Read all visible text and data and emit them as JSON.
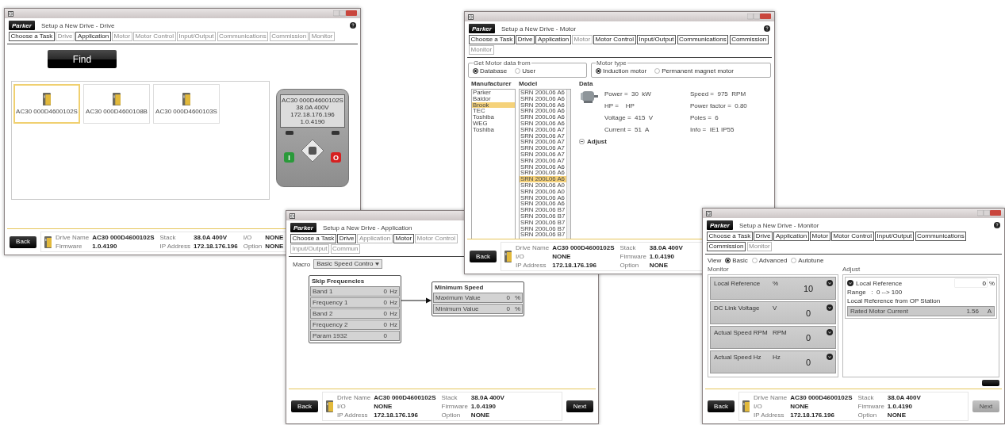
{
  "windows": [
    {
      "kind": "drive",
      "title": "Setup a New Drive - Drive",
      "logo": "Parker",
      "tabs": [
        {
          "label": "Choose a Task",
          "disabled": false
        },
        {
          "label": "Drive",
          "disabled": true
        },
        {
          "label": "Application",
          "disabled": false
        },
        {
          "label": "Motor",
          "disabled": true
        },
        {
          "label": "Motor Control",
          "disabled": true
        },
        {
          "label": "Input/Output",
          "disabled": true
        },
        {
          "label": "Communications",
          "disabled": true
        },
        {
          "label": "Commission",
          "disabled": true
        },
        {
          "label": "Monitor",
          "disabled": true
        }
      ],
      "find_button": "Find",
      "devices": [
        {
          "name": "AC30 000D4600102S",
          "selected": true
        },
        {
          "name": "AC30 000D4600108B",
          "selected": false
        },
        {
          "name": "AC30 000D4600103S",
          "selected": false
        }
      ],
      "keypad": {
        "lines": [
          "AC30 000D4600102S",
          "38.0A 400V",
          "172.18.176.196",
          "1.0.4190"
        ],
        "start_key": "I",
        "stop_key": "O"
      },
      "back_button": "Back",
      "drive_info": [
        {
          "label": "Drive Name",
          "value": "AC30 000D4600102S"
        },
        {
          "label": "Stack",
          "value": "38.0A 400V"
        },
        {
          "label": "I/O",
          "value": "NONE"
        },
        {
          "label": "Firmware",
          "value": "1.0.4190"
        },
        {
          "label": "IP Address",
          "value": "172.18.176.196"
        },
        {
          "label": "Option",
          "value": "NONE"
        }
      ]
    },
    {
      "kind": "application",
      "title": "Setup a New Drive - Application",
      "logo": "Parker",
      "tabs": [
        {
          "label": "Choose a Task",
          "disabled": false
        },
        {
          "label": "Drive",
          "disabled": false
        },
        {
          "label": "Application",
          "disabled": true
        },
        {
          "label": "Motor",
          "disabled": false
        },
        {
          "label": "Motor Control",
          "disabled": true
        },
        {
          "label": "Input/Output",
          "disabled": true
        },
        {
          "label": "Commun",
          "disabled": true
        }
      ],
      "macro": {
        "label": "Macro",
        "value": "Basic Speed Contro"
      },
      "blocks": [
        {
          "title": "Skip Frequencies",
          "rows": [
            {
              "name": "Band 1",
              "value": "0",
              "unit": "Hz"
            },
            {
              "name": "Frequency 1",
              "value": "0",
              "unit": "Hz"
            },
            {
              "name": "Band 2",
              "value": "0",
              "unit": "Hz"
            },
            {
              "name": "Frequency 2",
              "value": "0",
              "unit": "Hz"
            },
            {
              "name": "Param 1932",
              "value": "0"
            }
          ]
        },
        {
          "title": "Minimum Speed",
          "rows": [
            {
              "name": "Maximum Value",
              "value": "0",
              "unit": "%"
            },
            {
              "name": "Minimum Value",
              "value": "0",
              "unit": "%"
            }
          ]
        }
      ],
      "back_button": "Back",
      "drive_info": [
        {
          "label": "Drive Name",
          "value": "AC30 000D4600102S"
        },
        {
          "label": "Stack",
          "value": "38.0A 400V"
        },
        {
          "label": "I/O",
          "value": "NONE"
        },
        {
          "label": "Firmware",
          "value": "1.0.4190"
        },
        {
          "label": "IP Address",
          "value": "172.18.176.196"
        },
        {
          "label": "Option",
          "value": "NONE"
        }
      ],
      "next_button": {
        "label": "Next",
        "disabled": false
      }
    },
    {
      "kind": "motor",
      "title": "Setup a New Drive - Motor",
      "logo": "Parker",
      "tabs": [
        {
          "label": "Choose a Task",
          "disabled": false
        },
        {
          "label": "Drive",
          "disabled": false
        },
        {
          "label": "Application",
          "disabled": false
        },
        {
          "label": "Motor",
          "disabled": true
        },
        {
          "label": "Motor Control",
          "disabled": false
        },
        {
          "label": "Input/Output",
          "disabled": false
        },
        {
          "label": "Communications",
          "disabled": false
        },
        {
          "label": "Commission",
          "disabled": false
        },
        {
          "label": "Monitor",
          "disabled": true
        }
      ],
      "groups": [
        {
          "legend": "Get Motor data from",
          "options": [
            {
              "label": "Database",
              "selected": true
            },
            {
              "label": "User",
              "selected": false
            }
          ]
        },
        {
          "legend": "Motor type",
          "options": [
            {
              "label": "Induction motor",
              "selected": true
            },
            {
              "label": "Permanent magnet motor",
              "selected": false
            }
          ]
        }
      ],
      "manufacturer": {
        "heading": "Manufacturer",
        "items": [
          {
            "label": "Parker",
            "selected": false
          },
          {
            "label": "Baldor",
            "selected": false
          },
          {
            "label": "Brook",
            "selected": true
          },
          {
            "label": "TEC",
            "selected": false
          },
          {
            "label": "Toshiba",
            "selected": false
          },
          {
            "label": "WEG",
            "selected": false
          },
          {
            "label": "Toshiba",
            "selected": false
          }
        ]
      },
      "model": {
        "heading": "Model",
        "items": [
          {
            "label": "SRN 200L06 A6",
            "selected": false
          },
          {
            "label": "SRN 200L06 A6",
            "selected": false
          },
          {
            "label": "SRN 200L06 A6",
            "selected": false
          },
          {
            "label": "SRN 200L06 A6",
            "selected": false
          },
          {
            "label": "SRN 200L06 A6",
            "selected": false
          },
          {
            "label": "SRN 200L06 A6",
            "selected": false
          },
          {
            "label": "SRN 200L06 A7",
            "selected": false
          },
          {
            "label": "SRN 200L06 A7",
            "selected": false
          },
          {
            "label": "SRN 200L06 A7",
            "selected": false
          },
          {
            "label": "SRN 200L06 A7",
            "selected": false
          },
          {
            "label": "SRN 200L06 A7",
            "selected": false
          },
          {
            "label": "SRN 200L06 A7",
            "selected": false
          },
          {
            "label": "SRN 200L06 A6",
            "selected": false
          },
          {
            "label": "SRN 200L06 A6",
            "selected": false
          },
          {
            "label": "SRN 200L06 A6",
            "selected": true
          },
          {
            "label": "SRN 200L06 A0",
            "selected": false
          },
          {
            "label": "SRN 200L06 A0",
            "selected": false
          },
          {
            "label": "SRN 200L06 A6",
            "selected": false
          },
          {
            "label": "SRN 200L06 A6",
            "selected": false
          },
          {
            "label": "SRN 200L06 B7",
            "selected": false
          },
          {
            "label": "SRN 200L06 B7",
            "selected": false
          },
          {
            "label": "SRN 200L06 B7",
            "selected": false
          },
          {
            "label": "SRN 200L06 B7",
            "selected": false
          },
          {
            "label": "SRN 200L06 B7",
            "selected": false
          }
        ]
      },
      "data": {
        "heading": "Data",
        "fields": [
          "Power =  30  kW",
          "Speed =  975  RPM",
          "HP =    HP",
          "Power factor =  0.80",
          "Voltage =  415  V",
          "Poles =  6",
          "Current =  51  A",
          "Info =  IE1 IP55"
        ],
        "adjust": "Adjust"
      },
      "back_button": "Back",
      "drive_info": [
        {
          "label": "Drive Name",
          "value": "AC30 000D4600102S"
        },
        {
          "label": "Stack",
          "value": "38.0A 400V"
        },
        {
          "label": "I/O",
          "value": "NONE"
        },
        {
          "label": "Firmware",
          "value": "1.0.4190"
        },
        {
          "label": "IP Address",
          "value": "172.18.176.196"
        },
        {
          "label": "Option",
          "value": "NONE"
        }
      ]
    },
    {
      "kind": "monitor",
      "title": "Setup a New Drive - Monitor",
      "logo": "Parker",
      "tabs": [
        {
          "label": "Choose a Task",
          "disabled": false
        },
        {
          "label": "Drive",
          "disabled": false
        },
        {
          "label": "Application",
          "disabled": false
        },
        {
          "label": "Motor",
          "disabled": false
        },
        {
          "label": "Motor Control",
          "disabled": false
        },
        {
          "label": "Input/Output",
          "disabled": false
        },
        {
          "label": "Communications",
          "disabled": false
        },
        {
          "label": "Commission",
          "disabled": false
        },
        {
          "label": "Monitor",
          "disabled": true
        }
      ],
      "view": {
        "label": "View",
        "options": [
          {
            "label": "Basic",
            "selected": true
          },
          {
            "label": "Advanced",
            "selected": false
          },
          {
            "label": "Autotune",
            "selected": false
          }
        ]
      },
      "monitor_heading": "Monitor",
      "adjust_heading": "Adjust",
      "tiles": [
        {
          "name": "Local Reference",
          "unit": "%",
          "value": "10"
        },
        {
          "name": "DC Link Voltage",
          "unit": "V",
          "value": "0"
        },
        {
          "name": "Actual Speed RPM",
          "unit": "RPM",
          "value": "0"
        },
        {
          "name": "Actual Speed Hz",
          "unit": "Hz",
          "value": "0"
        }
      ],
      "adjust": {
        "name": "Local Reference",
        "value": "0",
        "unit": "%",
        "range": "Range   :  0 --> 100",
        "description": "Local Reference from OP Station",
        "rows": [
          {
            "name": "Rated Motor Current",
            "value": "1.56",
            "unit": "A"
          }
        ]
      },
      "back_button": "Back",
      "drive_info": [
        {
          "label": "Drive Name",
          "value": "AC30 000D4600102S"
        },
        {
          "label": "Stack",
          "value": "38.0A 400V"
        },
        {
          "label": "I/O",
          "value": "NONE"
        },
        {
          "label": "Firmware",
          "value": "1.0.4190"
        },
        {
          "label": "IP Address",
          "value": "172.18.176.196"
        },
        {
          "label": "Option",
          "value": "NONE"
        }
      ],
      "next_button": {
        "label": "Next",
        "disabled": true
      }
    }
  ]
}
